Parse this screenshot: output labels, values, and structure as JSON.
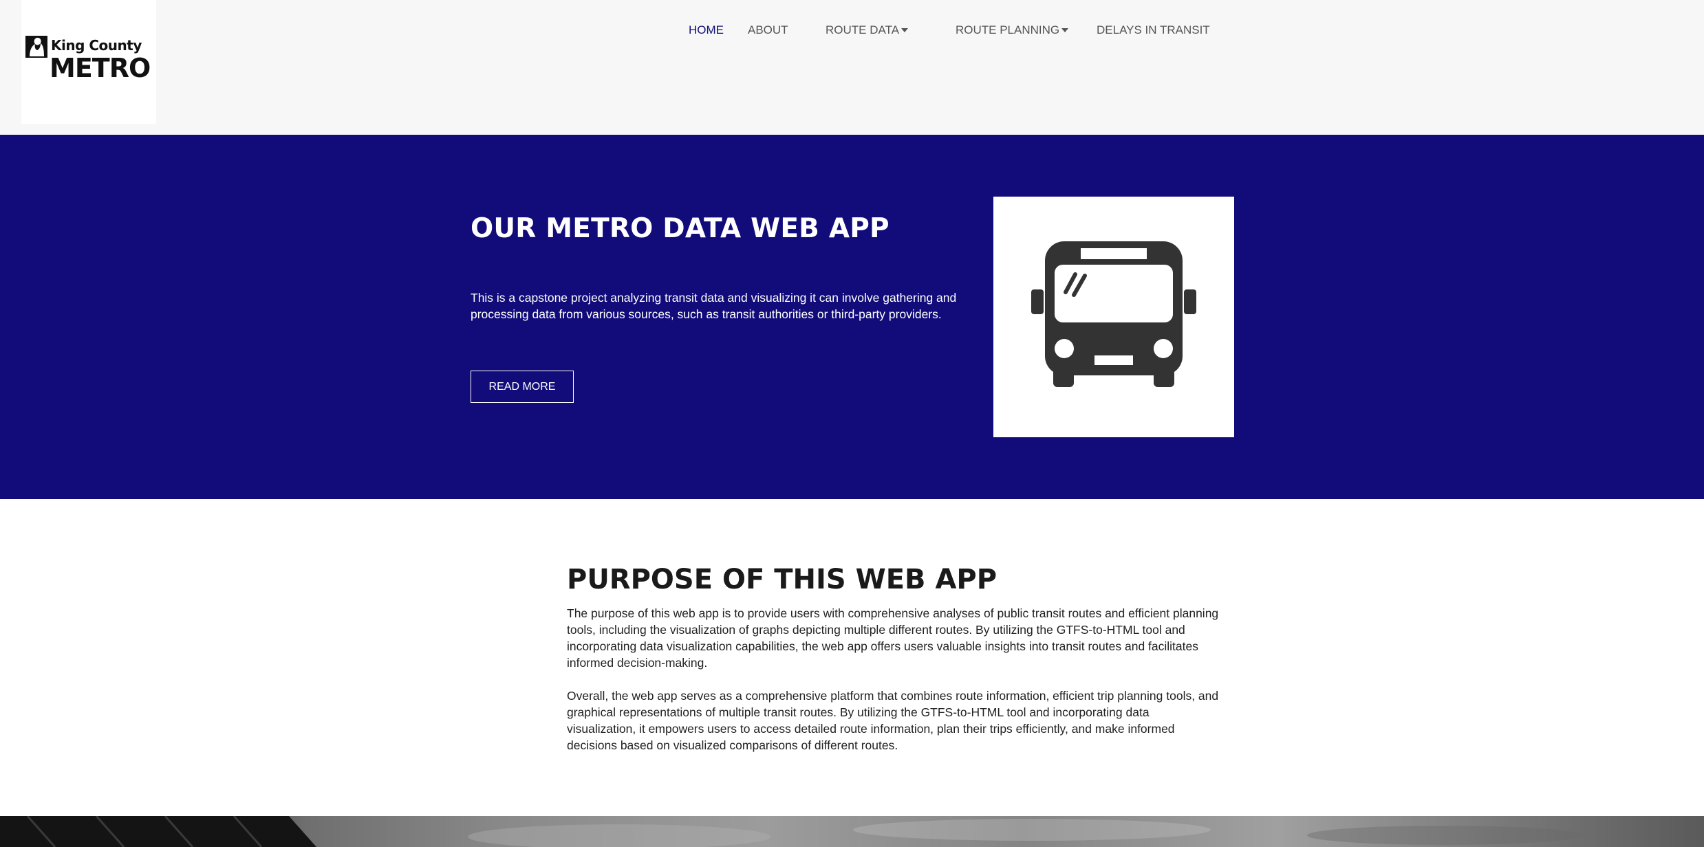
{
  "logo": {
    "line1": "King County",
    "line2": "METRO"
  },
  "nav": {
    "items": [
      {
        "label": "HOME",
        "active": true
      },
      {
        "label": "ABOUT"
      },
      {
        "label": "ROUTE DATA",
        "dropdown": true
      },
      {
        "label": "ROUTE PLANNING",
        "dropdown": true
      },
      {
        "label": "DELAYS IN TRANSIT"
      }
    ]
  },
  "hero": {
    "title": "OUR METRO DATA WEB APP",
    "text": "This is a capstone project analyzing transit data and visualizing it can involve gathering and processing data from various sources, such as transit authorities or third-party providers.",
    "button": "READ MORE",
    "image_icon": "bus-icon",
    "background_color": "#120c7a"
  },
  "purpose": {
    "title": "PURPOSE OF THIS WEB APP",
    "paragraph1": "The purpose of this web app is to provide users with comprehensive analyses of public transit routes and efficient planning tools, including the visualization of graphs depicting multiple different routes. By utilizing the GTFS-to-HTML tool and incorporating data visualization capabilities, the web app offers users valuable insights into transit routes and facilitates informed decision-making.",
    "paragraph2": "Overall, the web app serves as a comprehensive platform that combines route information, efficient trip planning tools, and graphical representations of multiple transit routes. By utilizing the GTFS-to-HTML tool and incorporating data visualization, it empowers users to access detailed route information, plan their trips efficiently, and make informed decisions based on visualized comparisons of different routes."
  },
  "colors": {
    "accent": "#120c7a",
    "nav_active": "#10107a",
    "nav_text": "#555555",
    "header_bg": "#f7f7f7"
  }
}
